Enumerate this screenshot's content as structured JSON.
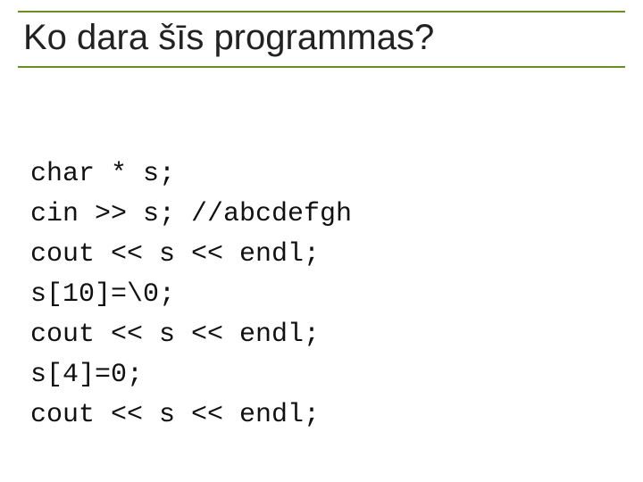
{
  "title": "Ko dara šīs programmas?",
  "code": {
    "lines": [
      "char * s;",
      "cin >> s; //abcdefgh",
      "cout << s << endl;",
      "s[10]=\\0;",
      "cout << s << endl;",
      "s[4]=0;",
      "cout << s << endl;"
    ]
  }
}
